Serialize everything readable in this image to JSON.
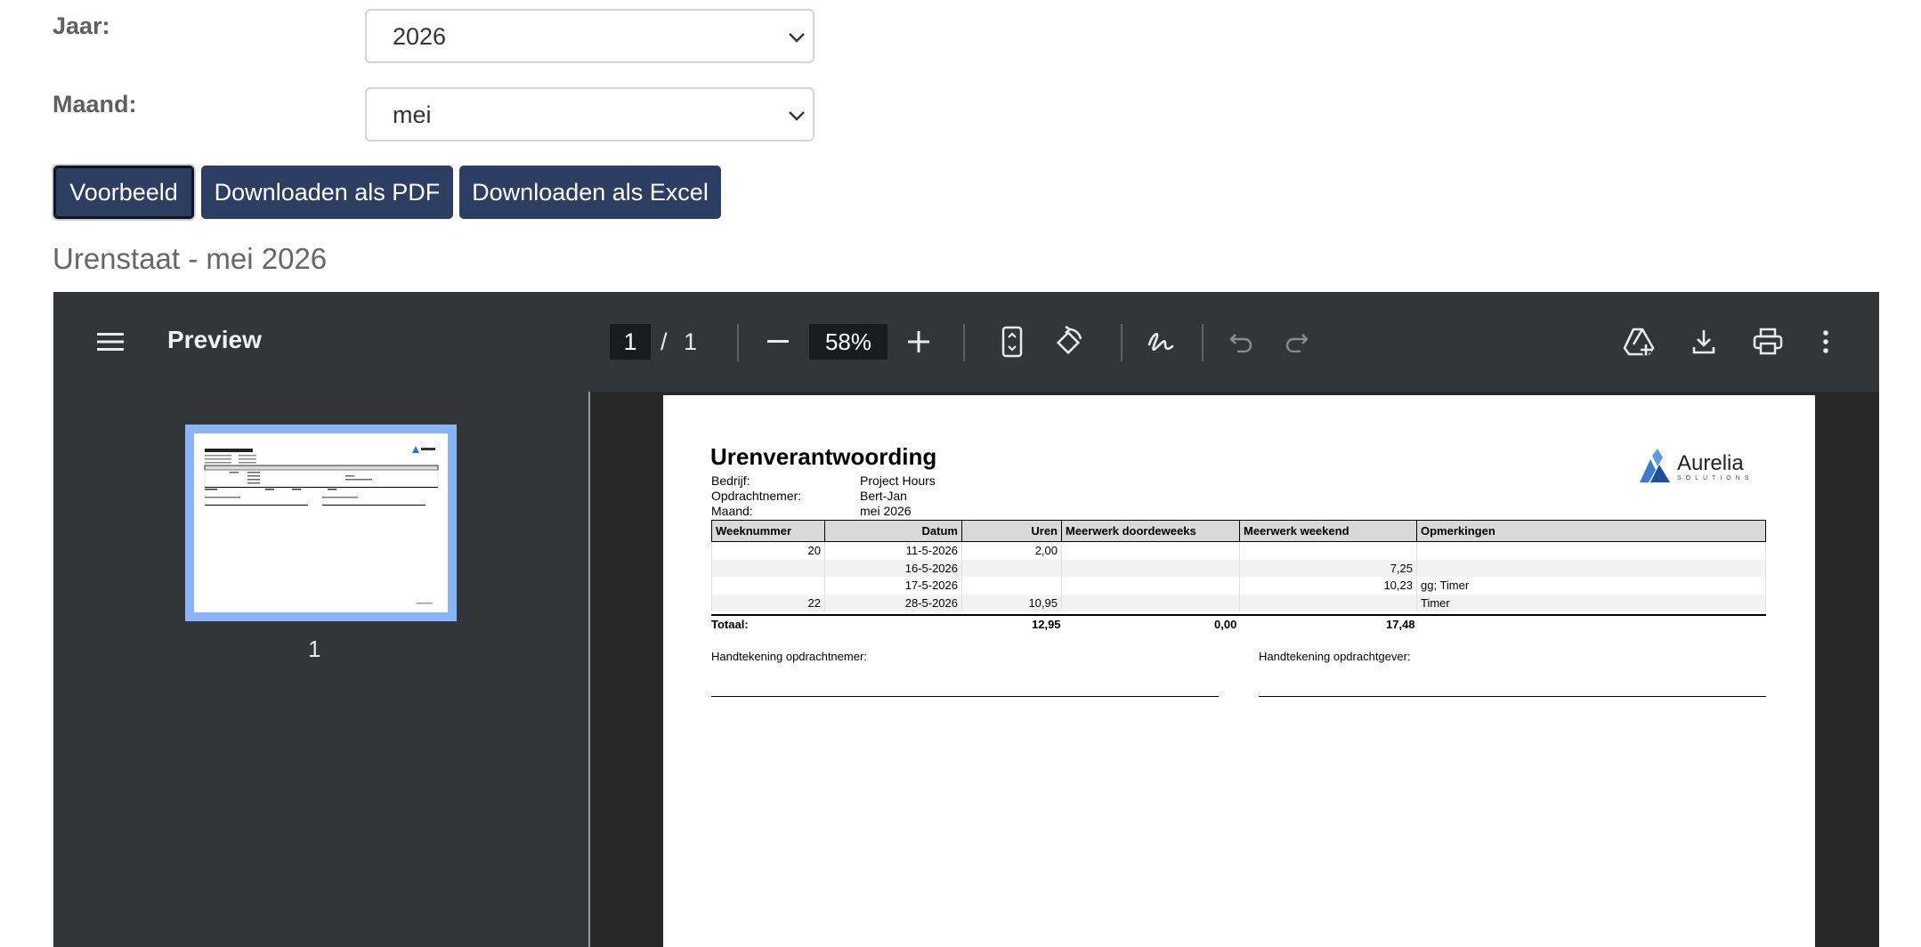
{
  "form": {
    "year_label": "Jaar:",
    "year_value": "2026",
    "month_label": "Maand:",
    "month_value": "mei"
  },
  "buttons": {
    "preview": "Voorbeeld",
    "download_pdf": "Downloaden als PDF",
    "download_excel": "Downloaden als Excel"
  },
  "heading": "Urenstaat - mei 2026",
  "viewer": {
    "title": "Preview",
    "current_page": "1",
    "page_separator": "/",
    "total_pages": "1",
    "zoom": "58%",
    "thumbnail_label": "1",
    "colors": {
      "toolbar": "#323639",
      "content": "#282828",
      "thumb_highlight": "#8ab4f8",
      "button": "#2d3e63"
    },
    "icons": [
      "menu-icon",
      "zoom-out-icon",
      "zoom-in-icon",
      "fit-page-icon",
      "rotate-icon",
      "annotate-icon",
      "undo-icon",
      "redo-icon",
      "drive-icon",
      "download-icon",
      "print-icon",
      "more-icon"
    ]
  },
  "document": {
    "title": "Urenverantwoording",
    "meta": [
      {
        "label": "Bedrijf:",
        "value": "Project Hours"
      },
      {
        "label": "Opdrachtnemer:",
        "value": "Bert-Jan"
      },
      {
        "label": "Maand:",
        "value": "mei 2026"
      }
    ],
    "logo": {
      "name": "Aurelia",
      "sub": "SOLUTIONS"
    },
    "columns": [
      "Weeknummer",
      "Datum",
      "Uren",
      "Meerwerk doordeweeks",
      "Meerwerk weekend",
      "Opmerkingen"
    ],
    "rows": [
      [
        "20",
        "11-5-2026",
        "2,00",
        "",
        "",
        ""
      ],
      [
        "",
        "16-5-2026",
        "",
        "",
        "7,25",
        ""
      ],
      [
        "",
        "17-5-2026",
        "",
        "",
        "10,23",
        "gg; Timer"
      ],
      [
        "22",
        "28-5-2026",
        "10,95",
        "",
        "",
        "Timer"
      ]
    ],
    "totals": {
      "label": "Totaal:",
      "uren": "12,95",
      "doordeweeks": "0,00",
      "weekend": "17,48"
    },
    "signature_contractor": "Handtekening opdrachtnemer:",
    "signature_client": "Handtekening opdrachtgever:"
  }
}
